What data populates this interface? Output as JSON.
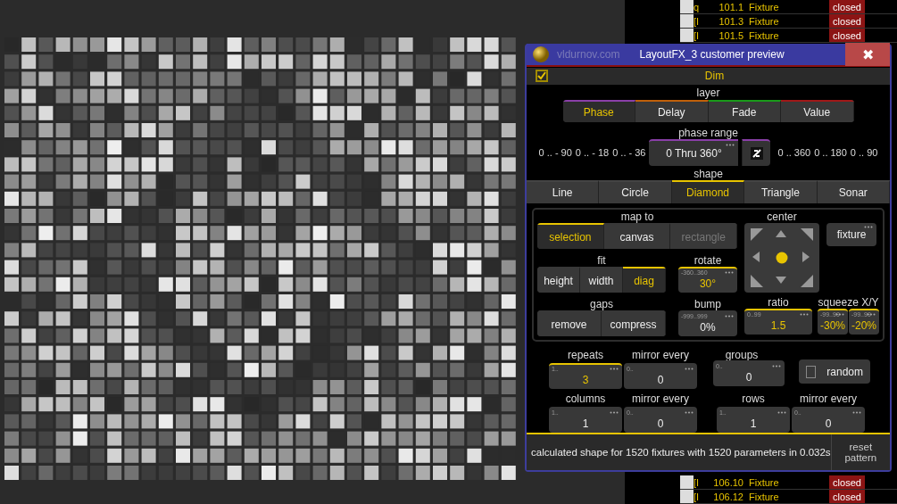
{
  "background_list": {
    "top_rows": [
      {
        "tag": "q",
        "id": "101.1",
        "name": "Fixture",
        "status": "closed"
      },
      {
        "tag": "[I",
        "id": "101.3",
        "name": "Fixture",
        "status": "closed"
      },
      {
        "tag": "[I",
        "id": "101.5",
        "name": "Fixture",
        "status": "closed"
      }
    ],
    "bottom_rows": [
      {
        "tag": "[I",
        "id": "106.10",
        "name": "Fixture",
        "status": "closed"
      },
      {
        "tag": "[I",
        "id": "106.12",
        "name": "Fixture",
        "status": "closed"
      }
    ]
  },
  "window": {
    "site": "vldurnov.com",
    "title": "LayoutFX_3 customer preview",
    "close": "✖"
  },
  "dim": {
    "label": "Dim",
    "checked": true
  },
  "layer": {
    "label": "layer",
    "tabs": [
      {
        "label": "Phase",
        "selected": true,
        "color": "#8a3fa8"
      },
      {
        "label": "Delay",
        "selected": false,
        "color": "#c0600a"
      },
      {
        "label": "Fade",
        "selected": false,
        "color": "#1a9a1a"
      },
      {
        "label": "Value",
        "selected": false,
        "color": "#a01818"
      }
    ]
  },
  "phase_range": {
    "label": "phase range",
    "left_presets": [
      "0 .. - 90",
      "0 .. - 18",
      "0 .. - 36"
    ],
    "value": "0 Thru 360°",
    "right_presets": [
      "0 .. 360",
      "0 .. 180",
      "0 .. 90"
    ]
  },
  "shape": {
    "label": "shape",
    "tabs": [
      {
        "label": "Line",
        "selected": false
      },
      {
        "label": "Circle",
        "selected": false
      },
      {
        "label": "Diamond",
        "selected": true
      },
      {
        "label": "Triangle",
        "selected": false
      },
      {
        "label": "Sonar",
        "selected": false
      }
    ]
  },
  "map_to": {
    "label": "map to",
    "options": [
      {
        "label": "selection",
        "selected": true,
        "disabled": false
      },
      {
        "label": "canvas",
        "selected": false,
        "disabled": false
      },
      {
        "label": "rectangle",
        "selected": false,
        "disabled": true
      }
    ]
  },
  "fit": {
    "label": "fit",
    "options": [
      {
        "label": "height",
        "selected": false
      },
      {
        "label": "width",
        "selected": false
      },
      {
        "label": "diag",
        "selected": true
      }
    ]
  },
  "rotate": {
    "label": "rotate",
    "range": "-360..360",
    "value": "30°",
    "active": true
  },
  "gaps": {
    "label": "gaps",
    "buttons": [
      "remove",
      "compress"
    ]
  },
  "bump": {
    "label": "bump",
    "range": "-999..999",
    "value": "0%",
    "active": false
  },
  "center": {
    "label": "center",
    "button": "fixture"
  },
  "ratio": {
    "label": "ratio",
    "range": "0..99",
    "value": "1.5",
    "active": true
  },
  "squeeze": {
    "label": "squeeze X/Y",
    "fields": [
      {
        "range": "-99..99",
        "value": "-30%",
        "active": true
      },
      {
        "range": "-99..99",
        "value": "-20%",
        "active": true
      }
    ]
  },
  "counts": {
    "row_1": [
      {
        "label": "repeats",
        "range": "1..",
        "value": "3",
        "active": true
      },
      {
        "label": "mirror every",
        "range": "0..",
        "value": "0",
        "active": false
      }
    ],
    "groups": {
      "label": "groups",
      "range": "0..",
      "value": "0",
      "active": false
    },
    "random": {
      "label": "random",
      "checked": false
    },
    "row_2": [
      {
        "label": "columns",
        "range": "1..",
        "value": "1",
        "active": false
      },
      {
        "label": "mirror every",
        "range": "0..",
        "value": "0",
        "active": false
      }
    ],
    "row_3": [
      {
        "label": "rows",
        "range": "1..",
        "value": "1",
        "active": false
      },
      {
        "label": "mirror every",
        "range": "0..",
        "value": "0",
        "active": false
      }
    ]
  },
  "status": {
    "message": "calculated shape for 1520 fixtures with 1520 parameters in 0.032s",
    "button": "reset pattern"
  }
}
